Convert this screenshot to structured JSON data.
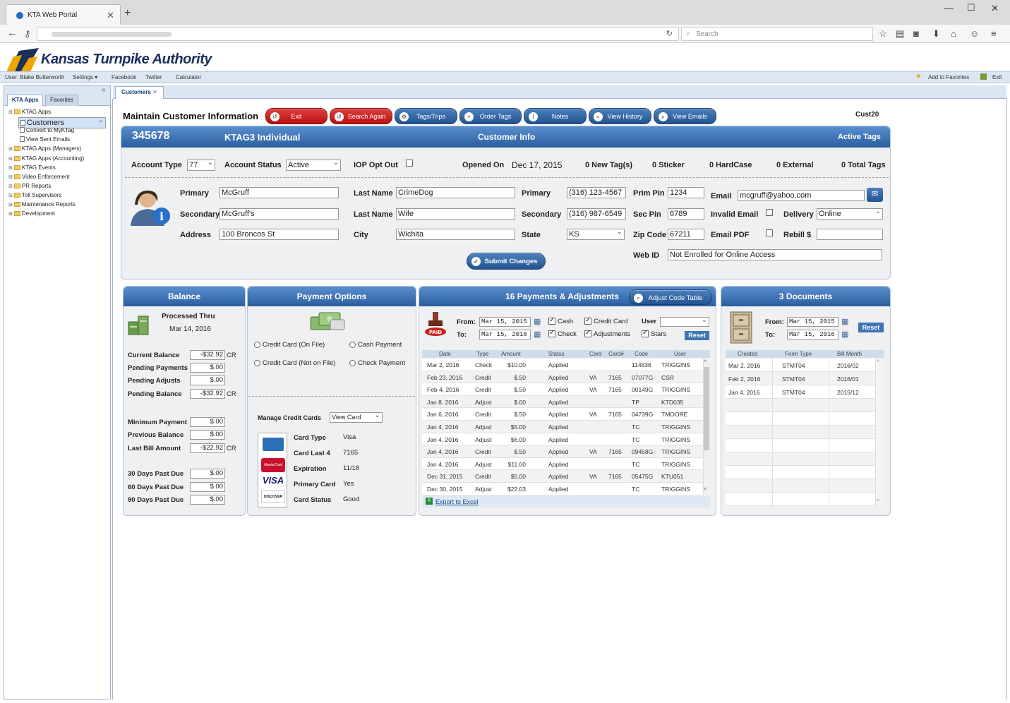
{
  "browser": {
    "tab_title": "KTA Web Portal",
    "search_placeholder": "Search"
  },
  "app": {
    "logo_text": "Kansas Turnpike Authority",
    "user_label": "User: Blake Butterworth",
    "settings": "Settings",
    "links": [
      "Facebook",
      "Twitter",
      "Calculator"
    ],
    "add_favorites": "Add to Favorites",
    "exit": "Exit"
  },
  "left_panel": {
    "tabs": [
      "KTA Apps",
      "Favorites"
    ],
    "tree": [
      {
        "label": "KTAG Apps",
        "type": "folder",
        "indent": 0
      },
      {
        "label": "Customers",
        "type": "doc",
        "indent": 1,
        "selected": true
      },
      {
        "label": "Convert to MyKTag",
        "type": "doc",
        "indent": 1
      },
      {
        "label": "View Sent Emails",
        "type": "doc",
        "indent": 1
      },
      {
        "label": "KTAG Apps (Managers)",
        "type": "folder",
        "indent": 0
      },
      {
        "label": "KTAG Apps (Accounting)",
        "type": "folder",
        "indent": 0
      },
      {
        "label": "KTAG Events",
        "type": "folder",
        "indent": 0
      },
      {
        "label": "Video Enforcement",
        "type": "folder",
        "indent": 0
      },
      {
        "label": "PR Reports",
        "type": "folder",
        "indent": 0
      },
      {
        "label": "Toll Supervisors",
        "type": "folder",
        "indent": 0
      },
      {
        "label": "Maintenance Reports",
        "type": "folder",
        "indent": 0
      },
      {
        "label": "Development",
        "type": "folder",
        "indent": 0
      }
    ]
  },
  "content_tab": "Customers",
  "toolbar": {
    "title": "Maintain Customer Information",
    "buttons": [
      "Exit",
      "Search Again",
      "Tags/Trips",
      "Order Tags",
      "Notes",
      "View History",
      "View Emails"
    ],
    "code": "Cust20"
  },
  "customer": {
    "account_number": "345678",
    "account_kind": "KTAG3 Individual",
    "header_center": "Customer Info",
    "header_right": "Active Tags",
    "account_type_label": "Account Type",
    "account_type": "77",
    "account_status_label": "Account Status",
    "account_status": "Active",
    "iop_label": "IOP Opt Out",
    "opened_label": "Opened On",
    "opened_on": "Dec 17, 2015",
    "tag_counts": [
      "0 New Tag(s)",
      "0 Sticker",
      "0 HardCase",
      "0 External",
      "0 Total Tags"
    ],
    "primary_label": "Primary",
    "primary_name": "McGruff",
    "secondary_label": "Secondary",
    "secondary_name": "McGruff's",
    "address_label": "Address",
    "address": "100 Broncos St",
    "last_name_label": "Last Name",
    "last_name_primary": "CrimeDog",
    "last_name_secondary": "Wife",
    "city_label": "City",
    "city": "Wichita",
    "phone_primary_label": "Primary",
    "phone_primary": "(316) 123-4567",
    "phone_secondary_label": "Secondary",
    "phone_secondary": "(316) 987-6549",
    "state_label": "State",
    "state": "KS",
    "prim_pin_label": "Prim Pin",
    "prim_pin": "1234",
    "sec_pin_label": "Sec Pin",
    "sec_pin": "6789",
    "zip_label": "Zip Code",
    "zip": "67211",
    "email_label": "Email",
    "email": "mcgruff@yahoo.com",
    "invalid_email_label": "Invalid Email",
    "delivery_label": "Delivery",
    "delivery": "Online",
    "email_pdf_label": "Email PDF",
    "rebill_label": "Rebill $",
    "rebill": "",
    "web_id_label": "Web ID",
    "web_id": "Not Enrolled for Online Access",
    "submit": "Submit Changes"
  },
  "balance": {
    "title": "Balance",
    "processed_label": "Processed Thru",
    "processed_date": "Mar 14, 2016",
    "rows": [
      {
        "label": "Current Balance",
        "value": "-$32.92",
        "suffix": "CR"
      },
      {
        "label": "Pending Payments",
        "value": "$.00",
        "suffix": ""
      },
      {
        "label": "Pending Adjusts",
        "value": "$.00",
        "suffix": ""
      },
      {
        "label": "Pending Balance",
        "value": "-$32.92",
        "suffix": "CR"
      },
      {
        "label": "Minimum Payment",
        "value": "$.00",
        "suffix": ""
      },
      {
        "label": "Previous Balance",
        "value": "$.00",
        "suffix": ""
      },
      {
        "label": "Last Bill Amount",
        "value": "-$22.92",
        "suffix": "CR"
      },
      {
        "label": "30 Days Past Due",
        "value": "$.00",
        "suffix": ""
      },
      {
        "label": "60 Days Past Due",
        "value": "$.00",
        "suffix": ""
      },
      {
        "label": "90 Days Past Due",
        "value": "$.00",
        "suffix": ""
      }
    ]
  },
  "payment_options": {
    "title": "Payment Options",
    "options": [
      "Credit Card (On File)",
      "Cash Payment",
      "Credit Card (Not on File)",
      "Check Payment"
    ],
    "manage_label": "Manage Credit Cards",
    "manage_select": "View Card",
    "card": [
      {
        "label": "Card Type",
        "value": "Visa"
      },
      {
        "label": "Card Last 4",
        "value": "7165"
      },
      {
        "label": "Expiration",
        "value": "11/18"
      },
      {
        "label": "Primary Card",
        "value": "Yes"
      },
      {
        "label": "Card Status",
        "value": "Good"
      }
    ],
    "card_logos": [
      "MasterCard",
      "VISA",
      "DISCOVER"
    ]
  },
  "payments": {
    "title": "16  Payments & Adjustments",
    "adjust_button": "Adjust Code Table",
    "from_label": "From:",
    "to_label": "To:",
    "from": "Mar 15, 2015",
    "to": "Mar 15, 2016",
    "filters": [
      "Cash",
      "Credit Card",
      "Check",
      "Adjustments",
      "Stars"
    ],
    "user_label": "User",
    "reset": "Reset",
    "columns": [
      "Date",
      "Type",
      "Amount",
      "Status",
      "Card",
      "Card#",
      "Code",
      "User"
    ],
    "rows": [
      [
        "Mar 2, 2016",
        "Check",
        "$10.00",
        "Applied",
        "",
        "",
        "114836",
        "TRIGGINS"
      ],
      [
        "Feb 23, 2016",
        "Credit",
        "$.50",
        "Applied",
        "VA",
        "7165",
        "07077G",
        "CSR"
      ],
      [
        "Feb 4, 2016",
        "Credit",
        "$.50",
        "Applied",
        "VA",
        "7165",
        "00149G",
        "TRIGGINS"
      ],
      [
        "Jan 8, 2016",
        "Adjust",
        "$.00",
        "Applied",
        "",
        "",
        "TP",
        "KTD035"
      ],
      [
        "Jan 6, 2016",
        "Credit",
        "$.50",
        "Applied",
        "VA",
        "7165",
        "04739G",
        "TMOORE"
      ],
      [
        "Jan 4, 2016",
        "Adjust",
        "$5.00",
        "Applied",
        "",
        "",
        "TC",
        "TRIGGINS"
      ],
      [
        "Jan 4, 2016",
        "Adjust",
        "$6.00",
        "Applied",
        "",
        "",
        "TC",
        "TRIGGINS"
      ],
      [
        "Jan 4, 2016",
        "Credit",
        "$.50",
        "Applied",
        "VA",
        "7165",
        "09458G",
        "TRIGGINS"
      ],
      [
        "Jan 4, 2016",
        "Adjust",
        "$11.00",
        "Applied",
        "",
        "",
        "TC",
        "TRIGGINS"
      ],
      [
        "Dec 31, 2015",
        "Credit",
        "$5.00",
        "Applied",
        "VA",
        "7165",
        "05475G",
        "KTU051"
      ],
      [
        "Dec 30, 2015",
        "Adjust",
        "$22.03",
        "Applied",
        "",
        "",
        "TC",
        "TRIGGINS"
      ]
    ],
    "export": "Export to Excel"
  },
  "documents": {
    "title": "3 Documents",
    "from_label": "From:",
    "to_label": "To:",
    "from": "Mar 15, 2015",
    "to": "Mar 15, 2016",
    "reset": "Reset",
    "columns": [
      "Created",
      "Form Type",
      "Bill Month"
    ],
    "rows": [
      [
        "Mar 2, 2016",
        "STMT04",
        "2016/02"
      ],
      [
        "Feb 2, 2016",
        "STMT04",
        "2016/01"
      ],
      [
        "Jan 4, 2016",
        "STMT04",
        "2015/12"
      ]
    ]
  }
}
